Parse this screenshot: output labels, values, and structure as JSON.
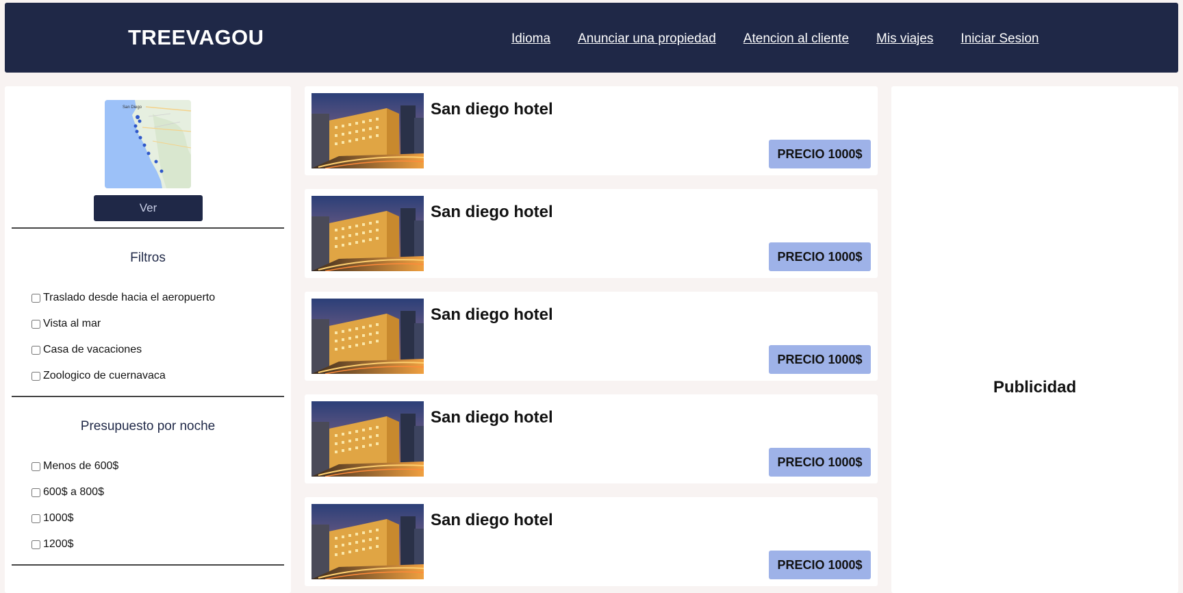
{
  "header": {
    "brand": "TREEVAGOU",
    "nav": [
      "Idioma",
      "Anunciar una propiedad",
      "Atencion al cliente",
      "Mis viajes",
      "Iniciar Sesion"
    ]
  },
  "sidebar": {
    "ver_label": "Ver",
    "filters_title": "Filtros",
    "filters": [
      "Traslado desde hacia el aeropuerto",
      "Vista al mar",
      "Casa de vacaciones",
      "Zoologico de cuernavaca"
    ],
    "budget_title": "Presupuesto por noche",
    "budget": [
      "Menos de 600$",
      "600$ a 800$",
      "1000$",
      "1200$"
    ]
  },
  "hotels": [
    {
      "name": "San diego hotel",
      "price": "PRECIO 1000$"
    },
    {
      "name": "San diego hotel",
      "price": "PRECIO 1000$"
    },
    {
      "name": "San diego hotel",
      "price": "PRECIO 1000$"
    },
    {
      "name": "San diego hotel",
      "price": "PRECIO 1000$"
    },
    {
      "name": "San diego hotel",
      "price": "PRECIO 1000$"
    }
  ],
  "ad": {
    "label": "Publicidad"
  },
  "colors": {
    "navy": "#1f2847",
    "price_bg": "#9eb2e8",
    "page_bg": "#f8f3f2"
  }
}
